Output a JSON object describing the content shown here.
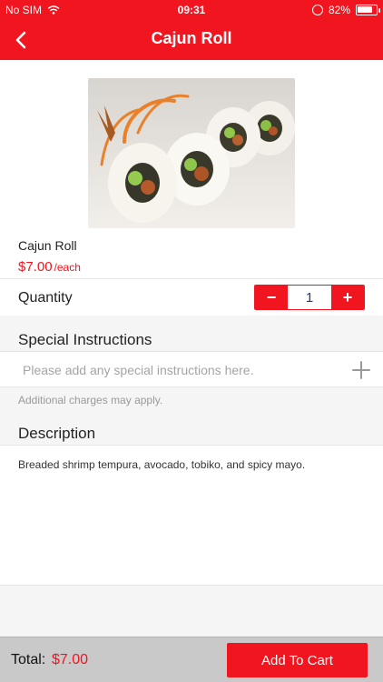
{
  "status": {
    "carrier": "No SIM",
    "time": "09:31",
    "battery_text": "82%",
    "battery_level": 0.82
  },
  "nav": {
    "title": "Cajun Roll",
    "back_icon": "chevron-left-icon"
  },
  "product": {
    "name": "Cajun Roll",
    "price": "$7.00",
    "price_unit": "/each"
  },
  "quantity": {
    "label": "Quantity",
    "value": "1",
    "decrement_symbol": "−",
    "increment_symbol": "+"
  },
  "instructions": {
    "title": "Special Instructions",
    "placeholder": "Please add any special instructions here.",
    "note": "Additional charges may apply."
  },
  "description": {
    "title": "Description",
    "text": "Breaded shrimp tempura, avocado, tobiko, and spicy mayo."
  },
  "footer": {
    "total_label": "Total:",
    "total_value": "$7.00",
    "cta_label": "Add To Cart"
  },
  "colors": {
    "brand_red": "#f0151f",
    "panel_gray": "#f5f5f5",
    "footer_gray": "#c9c9c9"
  }
}
